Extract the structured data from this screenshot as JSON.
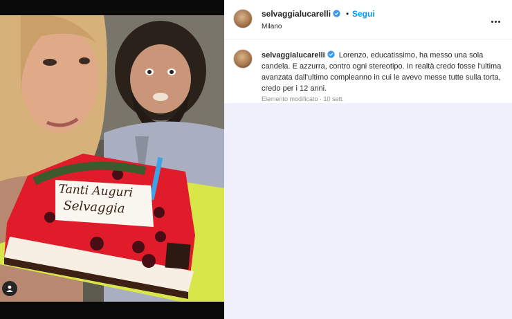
{
  "post": {
    "username": "selvaggialucarelli",
    "dot": "•",
    "follow_label": "Segui",
    "location": "Milano",
    "more_icon": "more-horizontal-icon",
    "caption": {
      "username": "selvaggialucarelli",
      "text": "Lorenzo, educatissimo, ha messo una sola candela. E azzurra, contro ogni stereotipo. In realtà credo fosse l'ultima avanzata dall'ultimo compleanno in cui le avevo messe tutte sulla torta, credo per i 12 anni."
    },
    "meta": "Elemento modificato · 10 sett."
  },
  "photo": {
    "cake_text_line1": "Tanti Auguri",
    "cake_text_line2": "Selvaggia",
    "user_tag_icon": "user-tag-icon"
  },
  "colors": {
    "follow": "#0095f6",
    "verified": "#3897f0",
    "panel_bg": "#eff0fc",
    "cake_red": "#e11c2a",
    "candle_blue": "#3ea2e6"
  }
}
